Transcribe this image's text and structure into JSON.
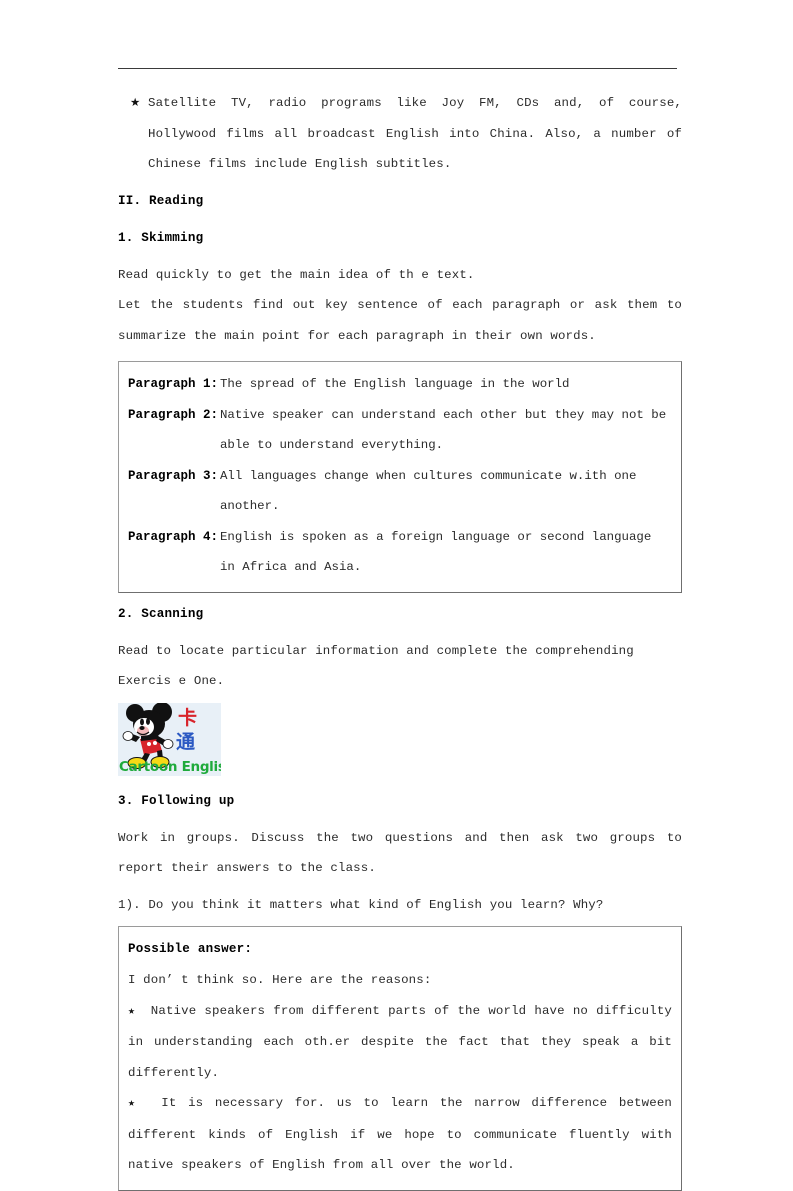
{
  "document": {
    "header_rule": true,
    "bullet_glyph": "★"
  },
  "intro_bullet": {
    "text": "Satellite TV, radio programs like Joy FM, CDs and, of course, Hollywood films all broadcast English into China. Also, a number of Chinese films include English subtitles."
  },
  "sections": {
    "reading_heading": "II. Reading",
    "skimming_heading": "1. Skimming",
    "skimming_line1": "Read quickly to get the main idea of th e text.",
    "skimming_line2": "Let the students find out key sentence of each paragraph or ask them to summarize the main point for each paragraph in their own words.",
    "scanning_heading": "2. Scanning",
    "scanning_line": "Read to locate particular information and complete the comprehending Exercis e One.",
    "following_up_heading": "3. Following up",
    "following_up_line": "Work in groups. Discuss the two questions and then ask two groups to report their answers to the class.",
    "question_one": "1). Do you think it matters what kind of English you learn? Why?"
  },
  "paragraph_box": {
    "rows": [
      {
        "label": "Paragraph 1:",
        "text": "The spread of the English language in the world"
      },
      {
        "label": "Paragraph 2:",
        "text": "Native speaker can understand each other but they may not be able to understand everything."
      },
      {
        "label": "Paragraph 3:",
        "text": "All languages change when cultures communicate w.ith one another."
      },
      {
        "label": "Paragraph 4:",
        "text": "English is spoken as a foreign language or second language in Africa and Asia."
      }
    ]
  },
  "logo": {
    "chinese_ka": "卡",
    "chinese_tong": "通",
    "caption": "Cartoon English",
    "background_color": "#e8f0f7",
    "ka_color": "#d8232a",
    "tong_color": "#2b59c3",
    "caption_color": "#1faa3c"
  },
  "answer_box": {
    "title": "Possible answer:",
    "lead": "I don’ t think so. Here are the reasons:",
    "bullets": [
      "Native speakers from different parts of the world have no difficulty in understanding each oth.er despite the fact that they speak a bit differently.",
      "It is necessary for. us to learn the narrow difference between different kinds of English if we hope to communicate fluently with native speakers of English from all over the world."
    ]
  }
}
